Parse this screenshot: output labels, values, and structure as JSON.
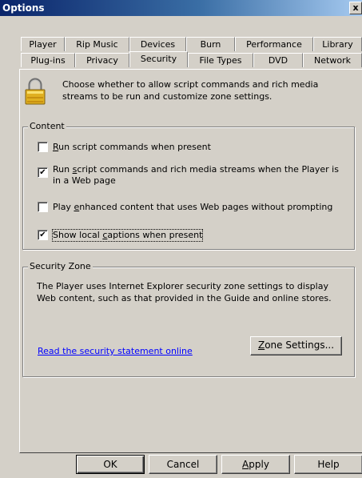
{
  "window": {
    "title": "Options",
    "close_glyph": "x"
  },
  "tabs": {
    "row1": [
      "Player",
      "Rip Music",
      "Devices",
      "Burn",
      "Performance",
      "Library"
    ],
    "row2": [
      "Plug-ins",
      "Privacy",
      "Security",
      "File Types",
      "DVD",
      "Network"
    ],
    "active": "Security"
  },
  "intro_text": "Choose whether to allow script commands and rich media streams to be run and customize zone settings.",
  "content_group": {
    "title": "Content",
    "options": [
      {
        "pre": "",
        "key": "R",
        "post": "un script commands when present",
        "checked": false
      },
      {
        "pre": "Run ",
        "key": "s",
        "post": "cript commands and rich media streams when the Player is in a Web page",
        "checked": true
      },
      {
        "pre": "Play ",
        "key": "e",
        "post": "nhanced content that uses Web pages without prompting",
        "checked": false
      },
      {
        "pre": "Show local ",
        "key": "c",
        "post": "aptions when present",
        "checked": true
      }
    ]
  },
  "zone_group": {
    "title": "Security Zone",
    "description": "The Player uses Internet Explorer security zone settings to display Web content, such as that provided in the Guide and online stores.",
    "link_text": "Read the security statement online",
    "zone_button": {
      "key": "Z",
      "rest": "one Settings..."
    }
  },
  "footer": {
    "ok": "OK",
    "cancel": "Cancel",
    "apply": {
      "key": "A",
      "rest": "pply"
    },
    "help": "Help"
  },
  "check_glyph": "✔",
  "icons": {
    "lock": "padlock-icon"
  }
}
